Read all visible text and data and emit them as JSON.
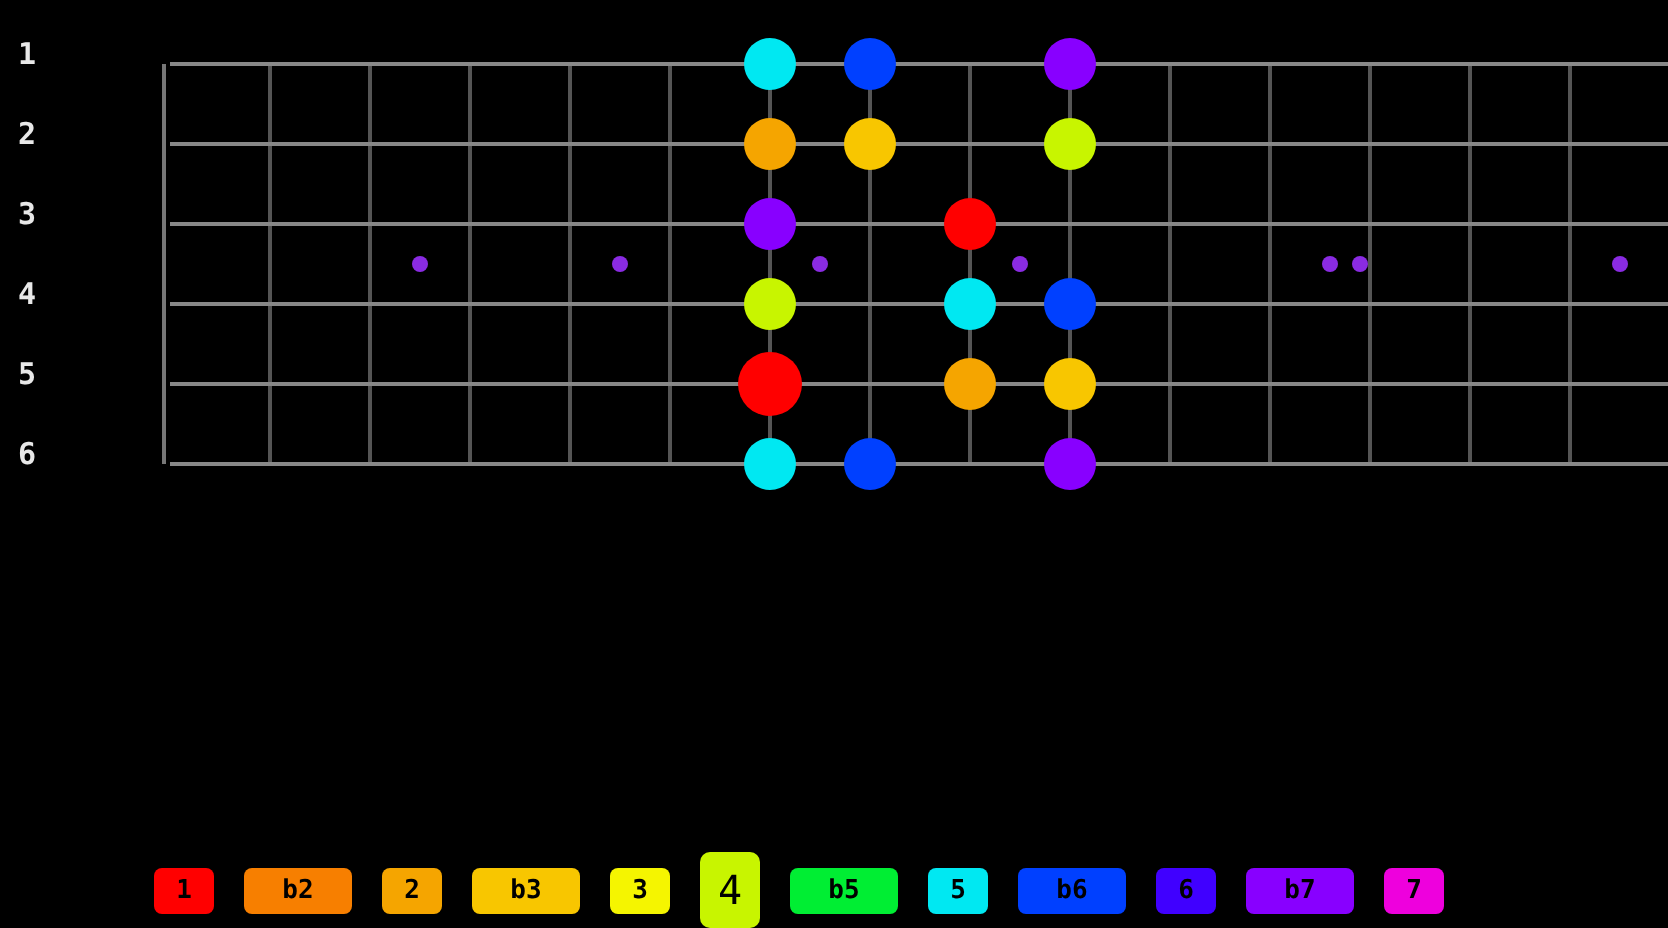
{
  "fretboard": {
    "inlays": [
      {
        "inlay": false
      },
      {
        "inlay": false
      },
      {
        "inlay": true,
        "double": false
      },
      {
        "inlay": false
      },
      {
        "inlay": true,
        "double": false
      },
      {
        "inlay": false
      },
      {
        "inlay": true,
        "double": false
      },
      {
        "inlay": false
      },
      {
        "inlay": true,
        "double": false
      },
      {
        "inlay": false
      },
      {
        "inlay": false
      },
      {
        "inlay": true,
        "double": true
      },
      {
        "inlay": false
      },
      {
        "inlay": false
      },
      {
        "inlay": true,
        "double": false
      }
    ],
    "strings": [
      {
        "label": "1",
        "frets": [
          {
            "dot": false
          },
          {
            "dot": false
          },
          {
            "dot": false
          },
          {
            "dot": false
          },
          {
            "dot": false
          },
          {
            "dot": false
          },
          {
            "dot": true,
            "color": "#00e8f2",
            "large": false
          },
          {
            "dot": true,
            "color": "#0040ff",
            "large": false
          },
          {
            "dot": false
          },
          {
            "dot": true,
            "color": "#8800ff",
            "large": false
          },
          {
            "dot": false
          },
          {
            "dot": false
          },
          {
            "dot": false
          },
          {
            "dot": false
          },
          {
            "dot": false
          }
        ]
      },
      {
        "label": "2",
        "frets": [
          {
            "dot": false
          },
          {
            "dot": false
          },
          {
            "dot": false
          },
          {
            "dot": false
          },
          {
            "dot": false
          },
          {
            "dot": false
          },
          {
            "dot": true,
            "color": "#f5a500",
            "large": false
          },
          {
            "dot": true,
            "color": "#f8c600",
            "large": false
          },
          {
            "dot": false
          },
          {
            "dot": true,
            "color": "#c8f500",
            "large": false
          },
          {
            "dot": false
          },
          {
            "dot": false
          },
          {
            "dot": false
          },
          {
            "dot": false
          },
          {
            "dot": false
          }
        ]
      },
      {
        "label": "3",
        "frets": [
          {
            "dot": false
          },
          {
            "dot": false
          },
          {
            "dot": false
          },
          {
            "dot": false
          },
          {
            "dot": false
          },
          {
            "dot": false
          },
          {
            "dot": true,
            "color": "#8800ff",
            "large": false
          },
          {
            "dot": false
          },
          {
            "dot": true,
            "color": "#ff0000",
            "large": false
          },
          {
            "dot": false
          },
          {
            "dot": false
          },
          {
            "dot": false
          },
          {
            "dot": false
          },
          {
            "dot": false
          },
          {
            "dot": false
          }
        ]
      },
      {
        "label": "4",
        "frets": [
          {
            "dot": false
          },
          {
            "dot": false
          },
          {
            "dot": false
          },
          {
            "dot": false
          },
          {
            "dot": false
          },
          {
            "dot": false
          },
          {
            "dot": true,
            "color": "#c8f500",
            "large": false
          },
          {
            "dot": false
          },
          {
            "dot": true,
            "color": "#00e8f2",
            "large": false
          },
          {
            "dot": true,
            "color": "#0040ff",
            "large": false
          },
          {
            "dot": false
          },
          {
            "dot": false
          },
          {
            "dot": false
          },
          {
            "dot": false
          },
          {
            "dot": false
          }
        ]
      },
      {
        "label": "5",
        "frets": [
          {
            "dot": false
          },
          {
            "dot": false
          },
          {
            "dot": false
          },
          {
            "dot": false
          },
          {
            "dot": false
          },
          {
            "dot": false
          },
          {
            "dot": true,
            "color": "#ff0000",
            "large": true
          },
          {
            "dot": false
          },
          {
            "dot": true,
            "color": "#f5a500",
            "large": false
          },
          {
            "dot": true,
            "color": "#f8c600",
            "large": false
          },
          {
            "dot": false
          },
          {
            "dot": false
          },
          {
            "dot": false
          },
          {
            "dot": false
          },
          {
            "dot": false
          }
        ]
      },
      {
        "label": "6",
        "frets": [
          {
            "dot": false
          },
          {
            "dot": false
          },
          {
            "dot": false
          },
          {
            "dot": false
          },
          {
            "dot": false
          },
          {
            "dot": false
          },
          {
            "dot": true,
            "color": "#00e8f2",
            "large": false
          },
          {
            "dot": true,
            "color": "#0040ff",
            "large": false
          },
          {
            "dot": false
          },
          {
            "dot": true,
            "color": "#8800ff",
            "large": false
          },
          {
            "dot": false
          },
          {
            "dot": false
          },
          {
            "dot": false
          },
          {
            "dot": false
          },
          {
            "dot": false
          }
        ]
      }
    ]
  },
  "legend": [
    {
      "label": "1",
      "color": "#ff0000",
      "selected": false
    },
    {
      "label": "b2",
      "color": "#f77f00",
      "selected": false
    },
    {
      "label": "2",
      "color": "#f5a500",
      "selected": false
    },
    {
      "label": "b3",
      "color": "#f8c600",
      "selected": false
    },
    {
      "label": "3",
      "color": "#f5f500",
      "selected": false
    },
    {
      "label": "4",
      "color": "#c8f500",
      "selected": true
    },
    {
      "label": "b5",
      "color": "#00ee33",
      "selected": false
    },
    {
      "label": "5",
      "color": "#00e8f2",
      "selected": false
    },
    {
      "label": "b6",
      "color": "#0040ff",
      "selected": false
    },
    {
      "label": "6",
      "color": "#4000ff",
      "selected": false
    },
    {
      "label": "b7",
      "color": "#8800ff",
      "selected": false
    },
    {
      "label": "7",
      "color": "#ee00dd",
      "selected": false
    }
  ]
}
